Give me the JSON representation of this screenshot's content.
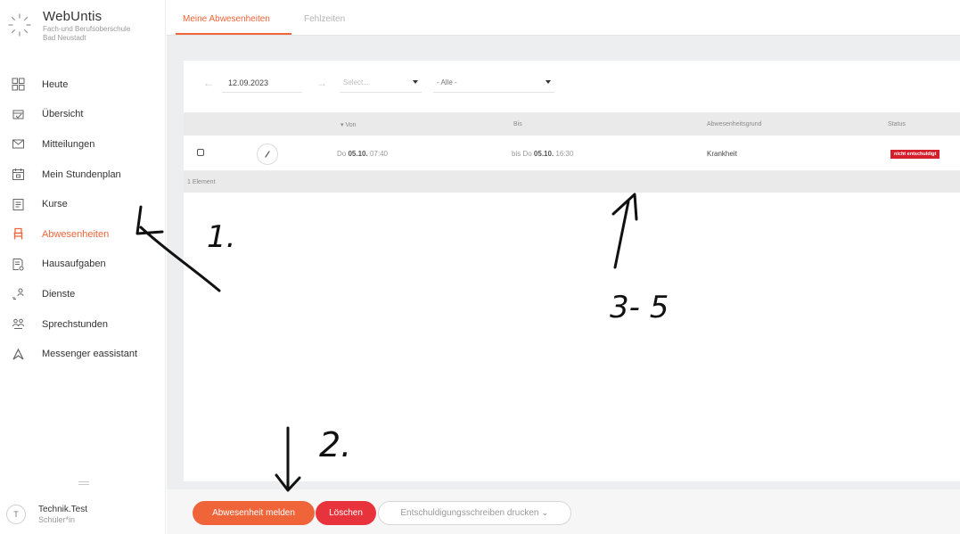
{
  "brand": {
    "title": "WebUntis",
    "school_line1": "Fach-und Berufsoberschule",
    "school_line2": "Bad Neustadt"
  },
  "nav": {
    "items": [
      {
        "label": "Heute",
        "icon": "dashboard-icon"
      },
      {
        "label": "Übersicht",
        "icon": "overview-icon"
      },
      {
        "label": "Mitteilungen",
        "icon": "mail-icon"
      },
      {
        "label": "Mein Stundenplan",
        "icon": "calendar-icon"
      },
      {
        "label": "Kurse",
        "icon": "courses-icon"
      },
      {
        "label": "Abwesenheiten",
        "icon": "absence-icon",
        "active": true
      },
      {
        "label": "Hausaufgaben",
        "icon": "homework-icon"
      },
      {
        "label": "Dienste",
        "icon": "duties-icon"
      },
      {
        "label": "Sprechstunden",
        "icon": "office-hours-icon"
      },
      {
        "label": "Messenger eassistant",
        "icon": "messenger-icon"
      }
    ]
  },
  "user": {
    "initial": "T",
    "name": "Technik.Test",
    "role": "Schüler*in"
  },
  "tabs": [
    {
      "label": "Meine Abwesenheiten",
      "active": true
    },
    {
      "label": "Fehlzeiten",
      "active": false
    }
  ],
  "filter": {
    "date": "12.09.2023",
    "select_placeholder": "Select...",
    "alle": "- Alle -"
  },
  "table": {
    "columns": {
      "von": "▾ Von",
      "bis": "Bis",
      "grund": "Abwesenheitsgrund",
      "status": "Status"
    },
    "rows": [
      {
        "von_day": "Do",
        "von_date": "05.10.",
        "von_time": "07:40",
        "bis_prefix": "bis Do",
        "bis_date": "05.10.",
        "bis_time": "16:30",
        "grund": "Krankheit",
        "status": "nicht entschuldigt"
      }
    ],
    "footer": "1 Element"
  },
  "actions": {
    "report": "Abwesenheit melden",
    "delete": "Löschen",
    "print": "Entschuldigungsschreiben drucken ⌄"
  },
  "annotations": {
    "step1": "1.",
    "step2": "2.",
    "step3": "3- 5"
  },
  "colors": {
    "accent": "#f0643a",
    "danger": "#e8333d",
    "status": "#d61f2c"
  }
}
